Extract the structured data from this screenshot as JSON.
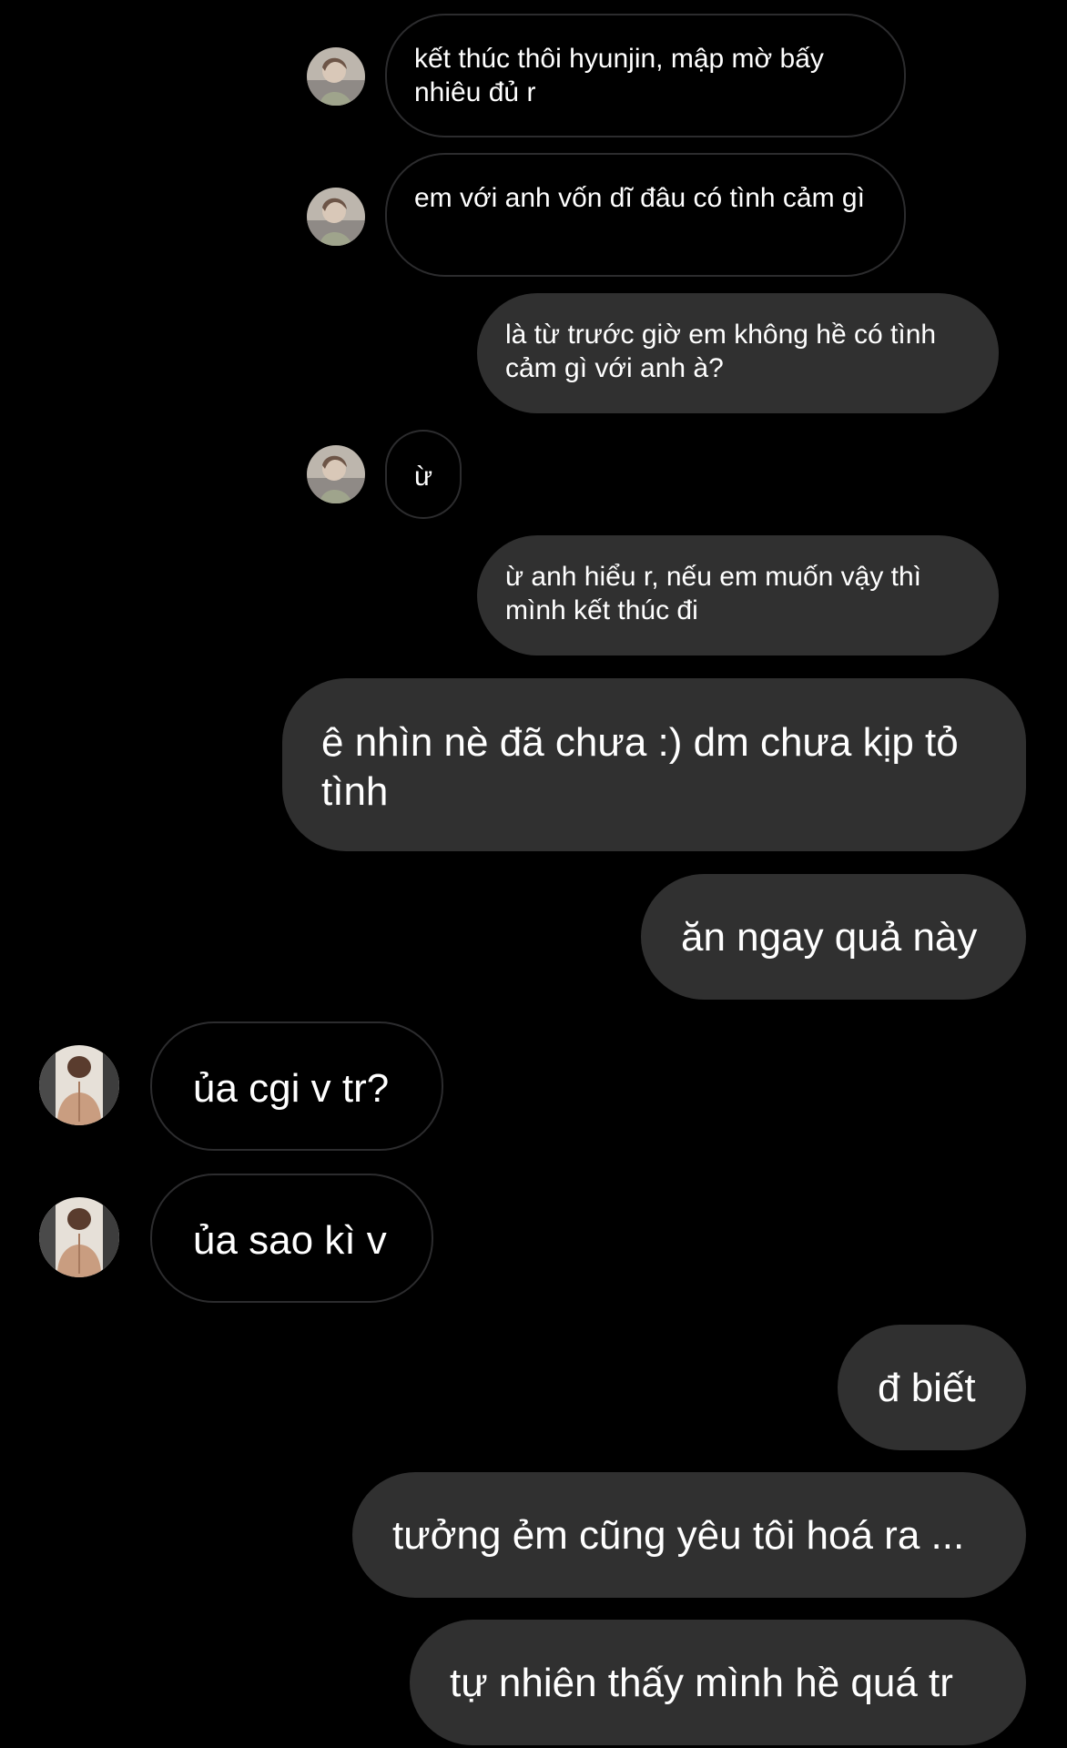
{
  "thread": {
    "messages": [
      {
        "side": "incoming",
        "text": "kết thúc thôi hyunjin, mập mờ bấy nhiêu đủ r"
      },
      {
        "side": "incoming",
        "text": "em với anh vốn dĩ đâu có tình cảm gì"
      },
      {
        "side": "outgoing",
        "text": "là từ trước giờ em không hề có tình cảm gì với anh à?"
      },
      {
        "side": "incoming",
        "text": "ừ"
      },
      {
        "side": "outgoing",
        "text": "ừ anh hiểu r, nếu em muốn vậy thì mình kết thúc đi"
      },
      {
        "side": "outgoing",
        "text": "ê nhìn nè đã chưa :) dm chưa kịp tỏ tình"
      },
      {
        "side": "outgoing",
        "text": "ăn ngay quả này"
      },
      {
        "side": "incoming",
        "text": "ủa cgi v tr?"
      },
      {
        "side": "incoming",
        "text": "ủa sao kì v"
      },
      {
        "side": "outgoing",
        "text": "đ biết"
      },
      {
        "side": "outgoing",
        "text": "tưởng ẻm cũng yêu tôi hoá ra ..."
      },
      {
        "side": "outgoing",
        "text": "tự nhiên thấy mình hề quá tr"
      }
    ]
  },
  "colors": {
    "background": "#000000",
    "outgoing_bubble": "#303030",
    "incoming_border": "#2c2c2e",
    "text": "#ffffff"
  },
  "avatars": {
    "inner_chat": "profile-photo-icon",
    "outer_chat": "profile-photo-icon"
  }
}
